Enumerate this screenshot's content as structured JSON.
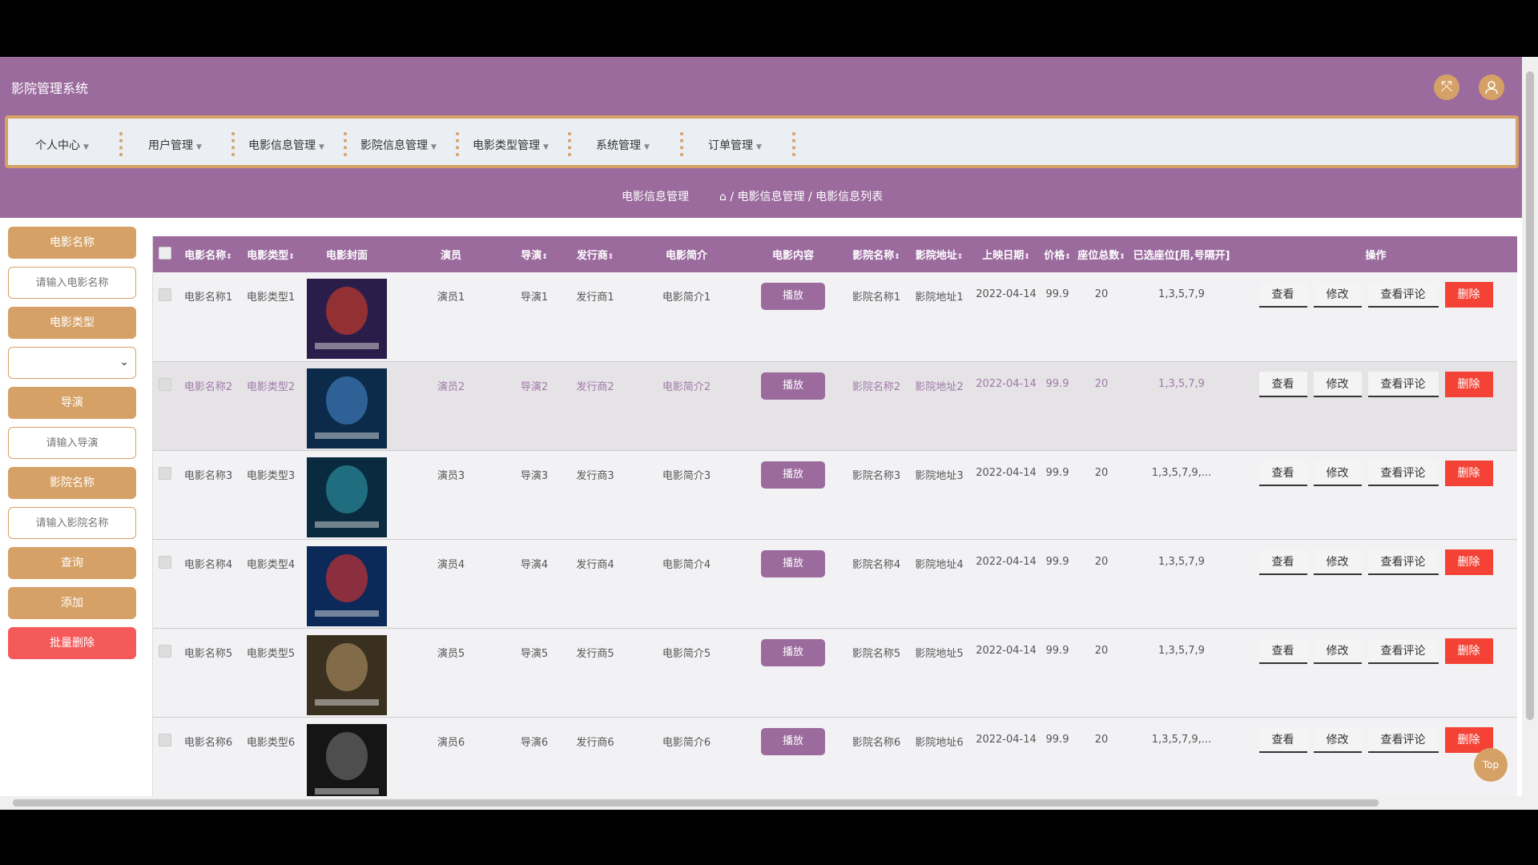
{
  "header": {
    "title": "影院管理系统",
    "fullscreen_icon": "expand-icon",
    "user_icon": "user-icon"
  },
  "nav": [
    {
      "label": "个人中心"
    },
    {
      "label": "用户管理"
    },
    {
      "label": "电影信息管理"
    },
    {
      "label": "影院信息管理"
    },
    {
      "label": "电影类型管理"
    },
    {
      "label": "系统管理"
    },
    {
      "label": "订单管理"
    }
  ],
  "breadcrumb": {
    "title": "电影信息管理",
    "path": "/ 电影信息管理 / 电影信息列表"
  },
  "search": {
    "movie_name_label": "电影名称",
    "movie_name_placeholder": "请输入电影名称",
    "movie_type_label": "电影类型",
    "movie_type_value": "",
    "director_label": "导演",
    "director_placeholder": "请输入导演",
    "cinema_name_label": "影院名称",
    "cinema_name_placeholder": "请输入影院名称",
    "query_label": "查询",
    "add_label": "添加",
    "batch_delete_label": "批量删除"
  },
  "table": {
    "headers": [
      "电影名称",
      "电影类型",
      "电影封面",
      "演员",
      "导演",
      "发行商",
      "电影简介",
      "电影内容",
      "影院名称",
      "影院地址",
      "上映日期",
      "价格",
      "座位总数",
      "已选座位[用,号隔开]",
      "操作"
    ],
    "rows": [
      {
        "name": "电影名称1",
        "type": "电影类型1",
        "actor": "演员1",
        "director": "导演1",
        "publisher": "发行商1",
        "intro": "电影简介1",
        "play": "播放",
        "cinema": "影院名称1",
        "address": "影院地址1",
        "date": "2022-04-14",
        "price": "99.9",
        "seats": "20",
        "selected": "1,3,5,7,9"
      },
      {
        "name": "电影名称2",
        "type": "电影类型2",
        "actor": "演员2",
        "director": "导演2",
        "publisher": "发行商2",
        "intro": "电影简介2",
        "play": "播放",
        "cinema": "影院名称2",
        "address": "影院地址2",
        "date": "2022-04-14",
        "price": "99.9",
        "seats": "20",
        "selected": "1,3,5,7,9"
      },
      {
        "name": "电影名称3",
        "type": "电影类型3",
        "actor": "演员3",
        "director": "导演3",
        "publisher": "发行商3",
        "intro": "电影简介3",
        "play": "播放",
        "cinema": "影院名称3",
        "address": "影院地址3",
        "date": "2022-04-14",
        "price": "99.9",
        "seats": "20",
        "selected": "1,3,5,7,9,..."
      },
      {
        "name": "电影名称4",
        "type": "电影类型4",
        "actor": "演员4",
        "director": "导演4",
        "publisher": "发行商4",
        "intro": "电影简介4",
        "play": "播放",
        "cinema": "影院名称4",
        "address": "影院地址4",
        "date": "2022-04-14",
        "price": "99.9",
        "seats": "20",
        "selected": "1,3,5,7,9"
      },
      {
        "name": "电影名称5",
        "type": "电影类型5",
        "actor": "演员5",
        "director": "导演5",
        "publisher": "发行商5",
        "intro": "电影简介5",
        "play": "播放",
        "cinema": "影院名称5",
        "address": "影院地址5",
        "date": "2022-04-14",
        "price": "99.9",
        "seats": "20",
        "selected": "1,3,5,7,9"
      },
      {
        "name": "电影名称6",
        "type": "电影类型6",
        "actor": "演员6",
        "director": "导演6",
        "publisher": "发行商6",
        "intro": "电影简介6",
        "play": "播放",
        "cinema": "影院名称6",
        "address": "影院地址6",
        "date": "2022-04-14",
        "price": "99.9",
        "seats": "20",
        "selected": "1,3,5,7,9,..."
      }
    ],
    "actions": {
      "view": "查看",
      "edit": "修改",
      "comments": "查看评论",
      "delete": "删除"
    }
  },
  "top_button": "Top",
  "colors": {
    "primary": "#9b6b9e",
    "accent": "#d6a167",
    "danger": "#f44336"
  }
}
